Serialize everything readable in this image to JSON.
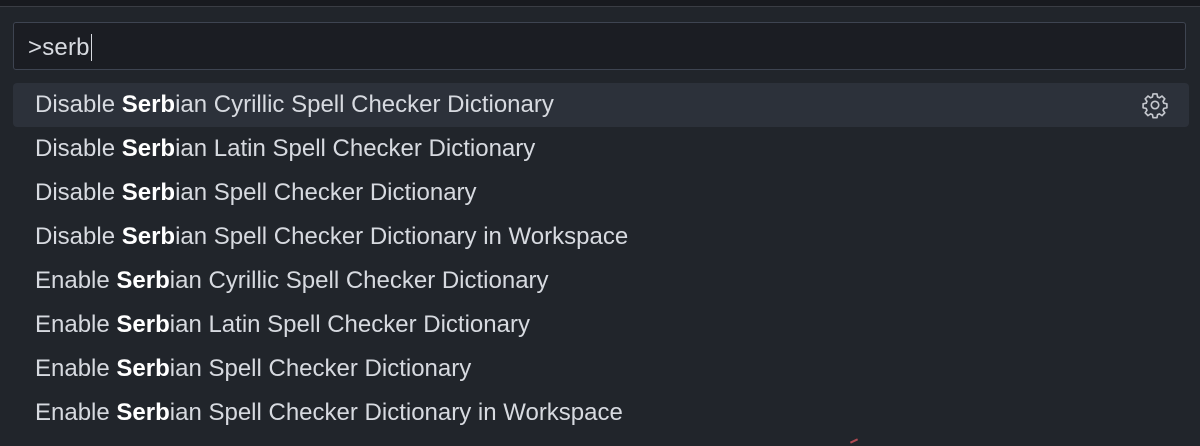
{
  "command_palette": {
    "query": ">serb",
    "items": [
      {
        "prefix": "Disable ",
        "match": "Serb",
        "suffix": "ian Cyrillic Spell Checker Dictionary",
        "selected": true,
        "action_icon": "gear-icon"
      },
      {
        "prefix": "Disable ",
        "match": "Serb",
        "suffix": "ian Latin Spell Checker Dictionary"
      },
      {
        "prefix": "Disable ",
        "match": "Serb",
        "suffix": "ian Spell Checker Dictionary"
      },
      {
        "prefix": "Disable ",
        "match": "Serb",
        "suffix": "ian Spell Checker Dictionary in Workspace"
      },
      {
        "prefix": "Enable ",
        "match": "Serb",
        "suffix": "ian Cyrillic Spell Checker Dictionary"
      },
      {
        "prefix": "Enable ",
        "match": "Serb",
        "suffix": "ian Latin Spell Checker Dictionary"
      },
      {
        "prefix": "Enable ",
        "match": "Serb",
        "suffix": "ian Spell Checker Dictionary"
      },
      {
        "prefix": "Enable ",
        "match": "Serb",
        "suffix": "ian Spell Checker Dictionary in Workspace"
      }
    ]
  },
  "colors": {
    "background": "#21252b",
    "selected_row": "#2c313a",
    "text": "#d7dae0",
    "match_text": "#ffffff",
    "input_border": "#3e4451"
  }
}
